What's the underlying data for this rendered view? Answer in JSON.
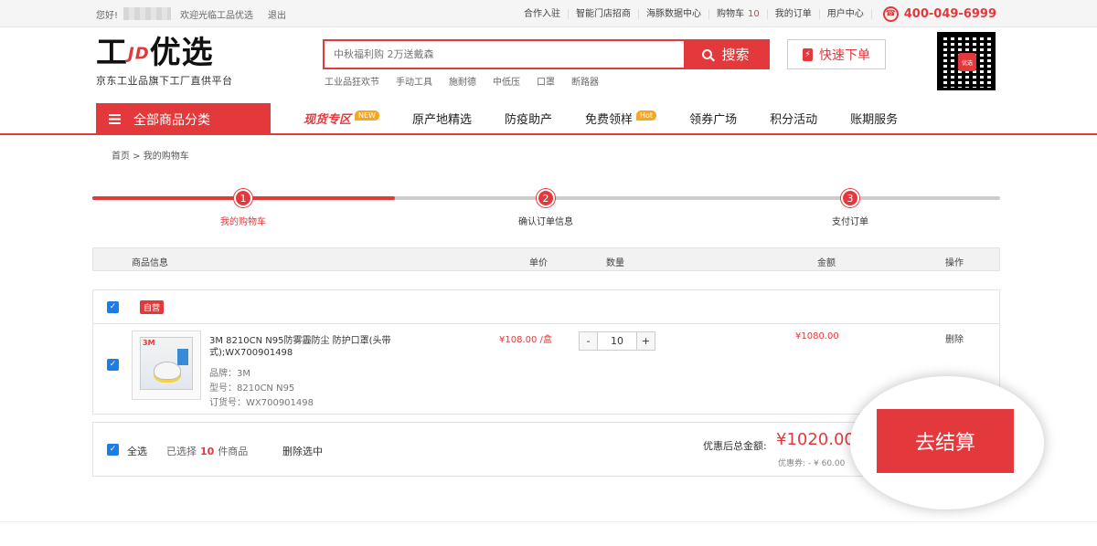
{
  "topbar": {
    "greeting": "您好!",
    "welcome": "欢迎光临工品优选",
    "logout": "退出",
    "links": [
      "合作入驻",
      "智能门店招商",
      "海豚数据中心",
      "购物车",
      "我的订单",
      "用户中心"
    ],
    "cart_count": "10",
    "phone": "400-049-6999",
    "phone_icon": "phone-icon"
  },
  "header": {
    "logo_left": "工",
    "logo_jd": "JD",
    "logo_right": "优选",
    "tagline": "京东工业品旗下工厂直供平台",
    "search_placeholder": "中秋福利购 2万送戴森",
    "search_button": "搜索",
    "hot_words": [
      "工业品狂欢节",
      "手动工具",
      "施耐德",
      "中低压",
      "口罩",
      "断路器"
    ],
    "quick_order": "快速下单",
    "qr_label": "优选"
  },
  "nav": {
    "all_categories": "全部商品分类",
    "items": [
      {
        "label": "现货专区",
        "badge": "NEW"
      },
      {
        "label": "原产地精选",
        "badge": ""
      },
      {
        "label": "防疫助产",
        "badge": ""
      },
      {
        "label": "免费领样",
        "badge": "Hot"
      },
      {
        "label": "领券广场",
        "badge": ""
      },
      {
        "label": "积分活动",
        "badge": ""
      },
      {
        "label": "账期服务",
        "badge": ""
      }
    ]
  },
  "breadcrumb": "首页 > 我的购物车",
  "steps": [
    {
      "num": "1",
      "label": "我的购物车"
    },
    {
      "num": "2",
      "label": "确认订单信息"
    },
    {
      "num": "3",
      "label": "支付订单"
    }
  ],
  "table_header": {
    "product_info": "商品信息",
    "unit_price": "单价",
    "quantity": "数量",
    "amount": "金额",
    "action": "操作"
  },
  "cart": {
    "shop_tag": "自营",
    "item": {
      "title": "3M 8210CN N95防雾霾防尘 防护口罩(头带式);WX700901498",
      "brand": "品牌：3M",
      "model": "型号：8210CN N95",
      "order_no": "订货号：WX700901498",
      "unit_price": "¥108.00 /盒",
      "quantity": "10",
      "minus": "-",
      "plus": "+",
      "amount": "¥1080.00",
      "delete": "删除"
    }
  },
  "footer": {
    "select_all": "全选",
    "selected_prefix": "已选择",
    "selected_count": "10",
    "selected_suffix": "件商品",
    "delete_selected": "删除选中",
    "total_label": "优惠后总金额:",
    "total_value": "¥1020.00",
    "coupon": "优惠券: - ¥ 60.00",
    "checkout": "去结算"
  },
  "colors": {
    "accent": "#e4393c",
    "checkbox": "#1e7ce6",
    "badge": "#f5a623"
  }
}
